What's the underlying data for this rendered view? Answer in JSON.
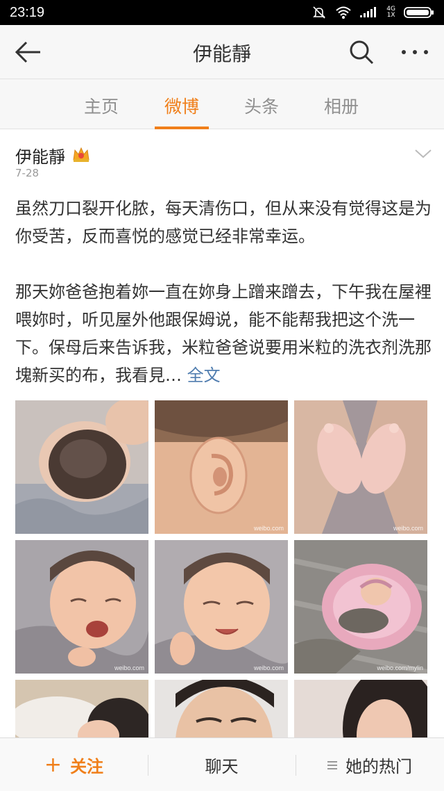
{
  "status_bar": {
    "time": "23:19",
    "net_top": "4G",
    "net_bottom": "1X"
  },
  "header": {
    "title": "伊能靜"
  },
  "tabs": [
    {
      "label": "主页"
    },
    {
      "label": "微博"
    },
    {
      "label": "头条"
    },
    {
      "label": "相册"
    }
  ],
  "active_tab_index": 1,
  "post": {
    "author": "伊能靜",
    "date": "7-28",
    "paragraph1": "虽然刀口裂开化脓，每天清伤口，但从来没有觉得这是为你受苦，反而喜悦的感觉已经非常幸运。",
    "paragraph2": "那天妳爸爸抱着妳一直在妳身上蹭来蹭去，下午我在屋裡喂妳时，听见屋外他跟保姆说，能不能帮我把这个洗一下。保母后来告诉我，米粒爸爸说要用米粒的洗衣剂洗那塊新买的布，我看見…",
    "full_text_link": "全文",
    "photos": [
      {
        "subject": "baby-head",
        "watermark": ""
      },
      {
        "subject": "baby-ear",
        "watermark": "weibo.com"
      },
      {
        "subject": "baby-feet-heart",
        "watermark": "weibo.com"
      },
      {
        "subject": "baby-yawning",
        "watermark": "weibo.com"
      },
      {
        "subject": "baby-smiling",
        "watermark": "weibo.com"
      },
      {
        "subject": "baby-pink-blanket",
        "watermark": "weibo.com/mylin"
      },
      {
        "subject": "baby-on-shoulder",
        "watermark": ""
      },
      {
        "subject": "father-portrait",
        "watermark": ""
      },
      {
        "subject": "mother-portrait",
        "watermark": ""
      }
    ]
  },
  "bottom_bar": {
    "follow_label": "关注",
    "chat_label": "聊天",
    "hot_label": "她的热门"
  },
  "colors": {
    "accent": "#f07f1a",
    "link": "#507daf",
    "text": "#333333",
    "muted": "#9a9a9a"
  }
}
